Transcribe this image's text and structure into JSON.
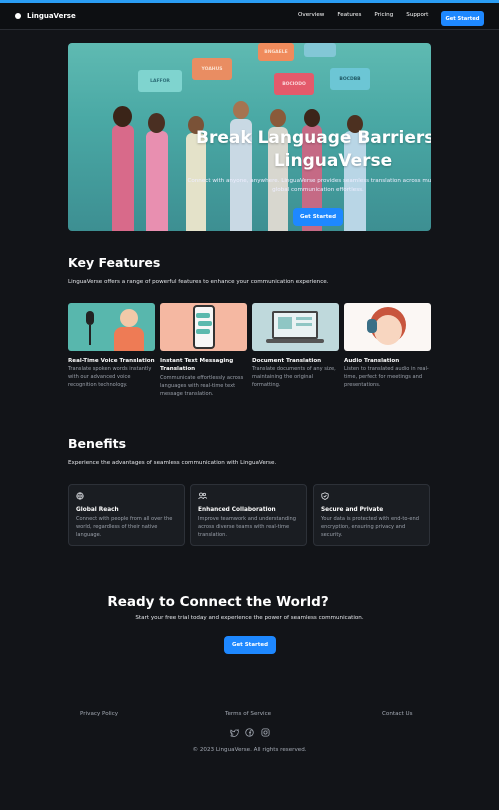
{
  "header": {
    "brand": "LinguaVerse",
    "nav": [
      "Overview",
      "Features",
      "Pricing",
      "Support"
    ],
    "cta": "Get Started"
  },
  "hero": {
    "title_line1": "Break Language Barriers wit",
    "title_line2": "LinguaVerse",
    "subtitle_line1": "Connect with anyone, anywhere. LinguaVerse provides seamless translation across multiple l",
    "subtitle_line2": "global communication effortless.",
    "button": "Get Started",
    "bubbles": [
      "LAFFOR",
      "YOAHUS",
      "BNGAELE",
      "BOCIODO",
      "BOCDBB"
    ]
  },
  "features": {
    "heading": "Key Features",
    "intro": "LinguaVerse offers a range of powerful features to enhance your communication experience.",
    "items": [
      {
        "title": "Real-Time Voice Translation",
        "desc": "Translate spoken words instantly with our advanced voice recognition technology."
      },
      {
        "title": "Instant Text Messaging Translation",
        "desc": "Communicate effortlessly across languages with real-time text message translation."
      },
      {
        "title": "Document Translation",
        "desc": "Translate documents of any size, maintaining the original formatting."
      },
      {
        "title": "Audio Translation",
        "desc": "Listen to translated audio in real-time, perfect for meetings and presentations."
      }
    ]
  },
  "benefits": {
    "heading": "Benefits",
    "intro": "Experience the advantages of seamless communication with LinguaVerse.",
    "items": [
      {
        "icon": "globe-icon",
        "title": "Global Reach",
        "desc": "Connect with people from all over the world, regardless of their native language."
      },
      {
        "icon": "users-icon",
        "title": "Enhanced Collaboration",
        "desc": "Improve teamwork and understanding across diverse teams with real-time translation."
      },
      {
        "icon": "shield-icon",
        "title": "Secure and Private",
        "desc": "Your data is protected with end-to-end encryption, ensuring privacy and security."
      }
    ]
  },
  "cta": {
    "title": "Ready to Connect the World?",
    "subtitle": "Start your free trial today and experience the power of seamless communication.",
    "button": "Get Started"
  },
  "footer": {
    "links": [
      "Privacy Policy",
      "Terms of Service",
      "Contact Us"
    ],
    "social": [
      "twitter-icon",
      "facebook-icon",
      "instagram-icon"
    ],
    "copyright": "© 2023 LinguaVerse. All rights reserved."
  },
  "colors": {
    "accent": "#1e88ff",
    "background": "#121418",
    "card": "#1a1d22"
  }
}
